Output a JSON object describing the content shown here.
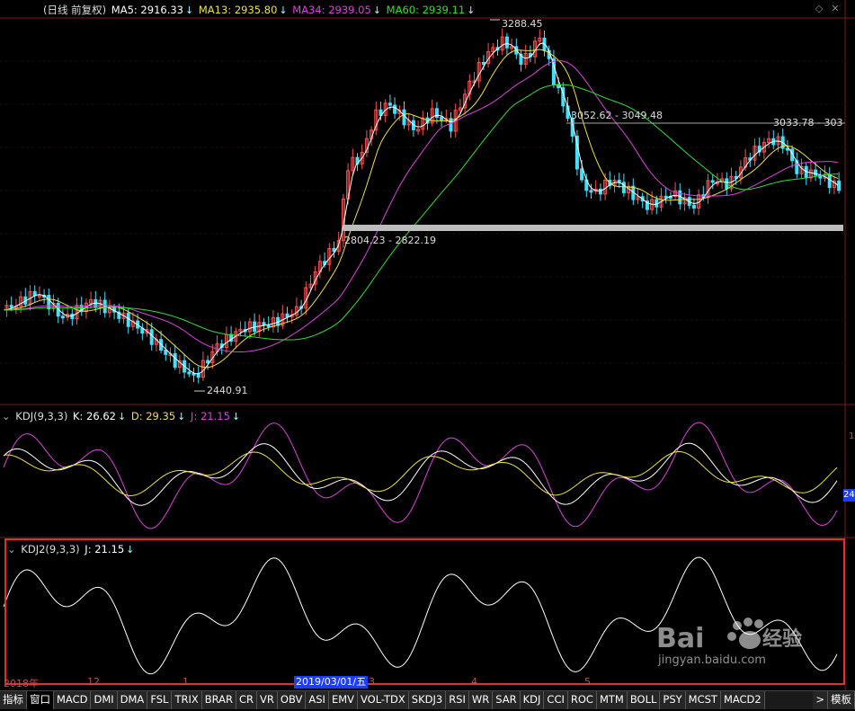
{
  "main_header": {
    "prefix": "(日线 前复权)",
    "ma5": "MA5: 2916.33",
    "ma13": "MA13: 2935.80",
    "ma34": "MA34: 2939.05",
    "ma60": "MA60: 2939.11",
    "arrow": "↓"
  },
  "kdj_header": {
    "name": "KDJ(9,3,3)",
    "k": "K: 26.62",
    "d": "D: 29.35",
    "j": "J: 21.15",
    "arrow": "↓",
    "right_label": "24"
  },
  "kdj2_header": {
    "name": "KDJ2(9,3,3)",
    "j": "J: 21.15",
    "arrow": "↓"
  },
  "annotations": {
    "high": "3288.45",
    "low": "2440.91",
    "range1": "3052.62 - 3049.48",
    "range2": "3033.78 - 303",
    "range3": "2804.23 - 2822.19"
  },
  "axis": {
    "x_labels": [
      "2018年",
      "12",
      "1",
      "3",
      "4",
      "5"
    ],
    "date_badge": "2019/03/01/五",
    "right_mark": "1"
  },
  "tabs": [
    "指标",
    "窗口",
    "MACD",
    "DMI",
    "DMA",
    "FSL",
    "TRIX",
    "BRAR",
    "CR",
    "VR",
    "OBV",
    "ASI",
    "EMV",
    "VOL-TDX",
    "SKDJ3",
    "RSI",
    "WR",
    "SAR",
    "KDJ",
    "CCI",
    "ROC",
    "MTM",
    "BOLL",
    "PSY",
    "MCST",
    "MACD2",
    ">",
    "模板"
  ],
  "watermark": {
    "brand": "Bai",
    "cn": "经验",
    "url": "jingyan.baidu.com"
  },
  "colors": {
    "ma5": "#ffffff",
    "ma13": "#f0e040",
    "ma34": "#e040e0",
    "ma60": "#30e030",
    "up": "#ff5050",
    "down": "#40e0ff",
    "highlight": "#e03030"
  },
  "icons": [
    "diamond-icon",
    "close-icon",
    "kdj-collapse-icon",
    "kdj2-collapse-icon"
  ]
}
